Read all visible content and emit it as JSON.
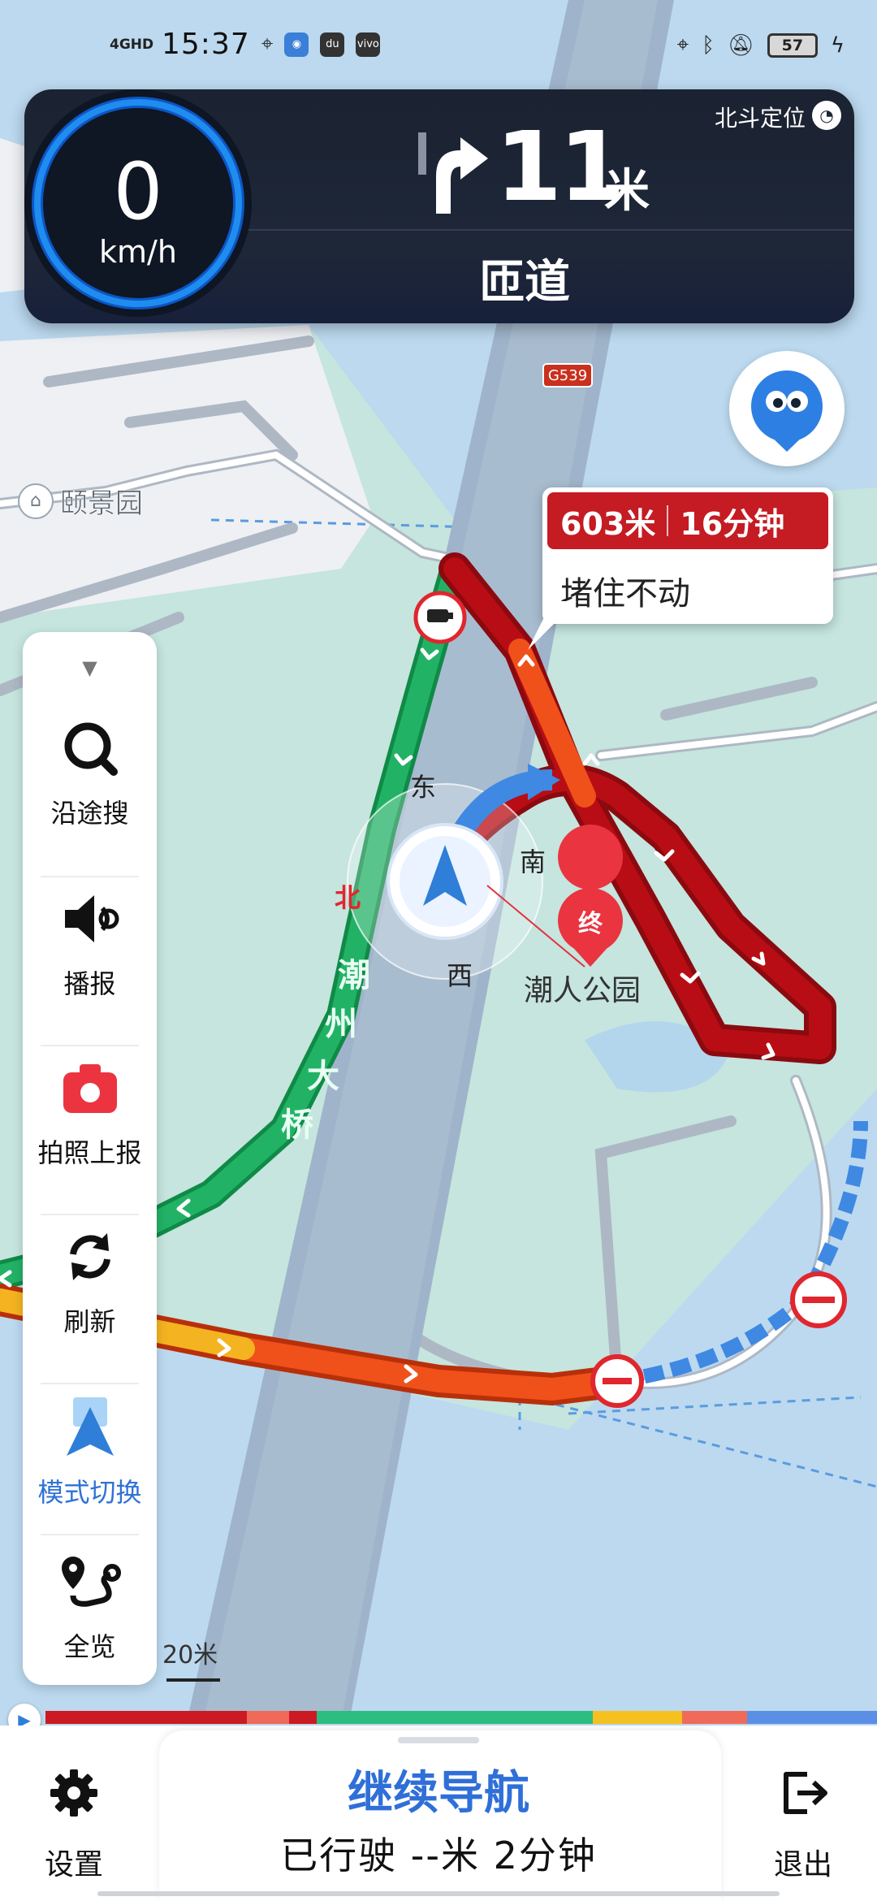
{
  "status_bar": {
    "network": "4GHD",
    "time": "15:37",
    "battery": "57",
    "app_icons": [
      "du",
      "vivo"
    ]
  },
  "banner": {
    "speed": "0",
    "speed_unit": "km/h",
    "distance": "11",
    "distance_unit": "米",
    "road": "匝道",
    "positioning": "北斗定位"
  },
  "map": {
    "poi_name": "颐景园",
    "highway_shield": "G539",
    "bridge_name": [
      "潮",
      "州",
      "大",
      "桥"
    ],
    "compass": {
      "north": "北",
      "east": "东",
      "south": "南",
      "west": "西"
    },
    "destination_marker": "终",
    "destination_name": "潮人公园"
  },
  "traffic_bubble": {
    "distance": "603米",
    "duration": "16分钟",
    "status": "堵住不动"
  },
  "toolbar": {
    "search": "沿途搜",
    "broadcast": "播报",
    "report": "拍照上报",
    "refresh": "刷新",
    "mode": "模式切换",
    "overview": "全览"
  },
  "scale": "20米",
  "bottom": {
    "settings": "设置",
    "resume": "继续导航",
    "trip": "已行驶  --米  2分钟",
    "exit": "退出"
  },
  "colors": {
    "jam": "#b80d14",
    "slow": "#f0501a",
    "smooth": "#1fa65e",
    "accent": "#2f6fd8",
    "amber": "#f4b321"
  }
}
